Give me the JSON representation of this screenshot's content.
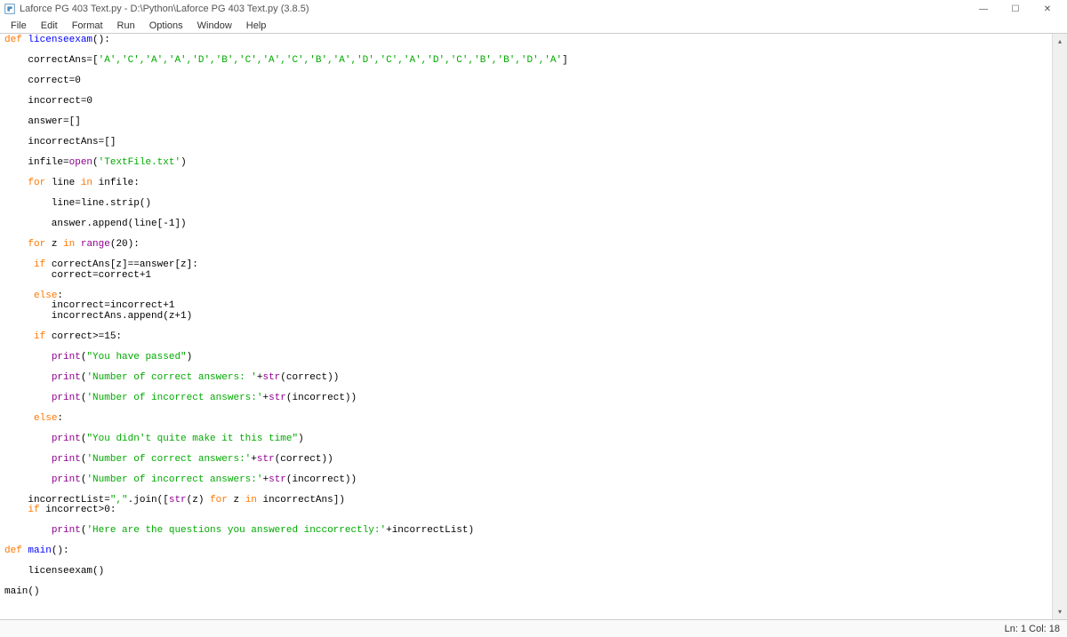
{
  "window": {
    "title": "Laforce PG 403 Text.py - D:\\Python\\Laforce PG 403 Text.py (3.8.5)"
  },
  "menu": {
    "file": "File",
    "edit": "Edit",
    "format": "Format",
    "run": "Run",
    "options": "Options",
    "window": "Window",
    "help": "Help"
  },
  "code": {
    "def1": "def",
    "fn1": "licenseexam",
    "line1_tail": "():",
    "line2_pre": "    correctAns=[",
    "line2_list": "'A','C','A','A','D','B','C','A','C','B','A','D','C','A','D','C','B','B','D','A'",
    "line2_post": "]",
    "line3": "    correct=0",
    "line4": "    incorrect=0",
    "line5": "    answer=[]",
    "line6": "    incorrectAns=[]",
    "line7_pre": "    infile=",
    "open": "open",
    "line7_str": "'TextFile.txt'",
    "line7_post": ")",
    "for": "for",
    "in": "in",
    "line8a": " line ",
    "line8b": " infile:",
    "line9": "        line=line.strip()",
    "line10": "        answer.append(line[-1])",
    "line11a": " z ",
    "range": "range",
    "line11b": "(20):",
    "if": "if",
    "line12": " correctAns[z]==answer[z]:",
    "line12b": "        correct=correct+1",
    "else": "else",
    "line13a": "        incorrect=incorrect+1",
    "line13b": "        incorrectAns.append(z+1)",
    "line14": " correct>=15:",
    "print": "print",
    "str15": "\"You have passed\"",
    "str16a": "'Number of correct answers: '",
    "str_fn": "str",
    "str16b": "(correct))",
    "str17a": "'Number of incorrect answers:'",
    "str17b": "(incorrect))",
    "str18": "\"You didn't quite make it this time\"",
    "str19a": "'Number of correct answers:'",
    "line20_pre": "    incorrectList=",
    "line20_str": "\",\"",
    "line20_mid": ".join([",
    "line20_post": "(z) ",
    "line20_end": " incorrectAns])",
    "line21": " incorrect>0:",
    "str22": "'Here are the questions you answered inccorrectly:'",
    "line22_post": "+incorrectList)",
    "fn2": "main",
    "line23": "():",
    "line24": "    licenseexam()",
    "line25": "main()"
  },
  "status": {
    "pos": "Ln: 1  Col: 18"
  }
}
